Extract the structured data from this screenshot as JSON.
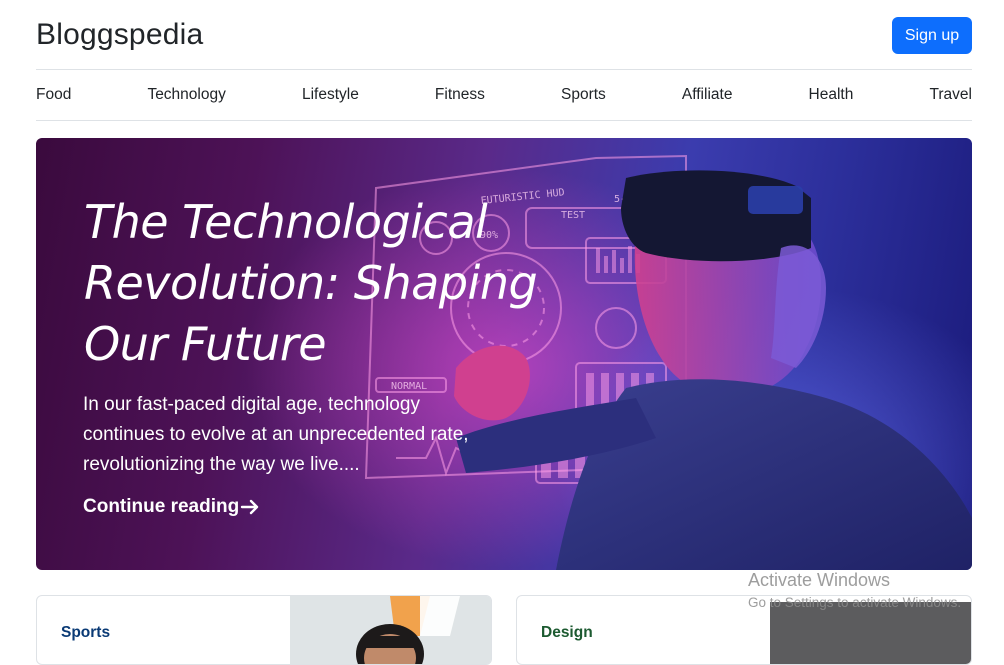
{
  "header": {
    "brand": "Bloggspedia",
    "signup_label": "Sign up"
  },
  "nav": {
    "items": [
      "Food",
      "Technology",
      "Lifestyle",
      "Fitness",
      "Sports",
      "Affiliate",
      "Health",
      "Travel"
    ]
  },
  "hero": {
    "title": "The Technological Revolution: Shaping Our Future",
    "lead": "In our fast-paced digital age, technology continues to evolve at an unprecedented rate, revolutionizing the way we live....",
    "link_label": "Continue reading",
    "link_icon": "arrow-right-icon",
    "hud_labels": [
      "FUTURISTIC HUD",
      "TEST",
      "90%",
      "NORMAL",
      "5-01"
    ]
  },
  "cards": [
    {
      "category": "Sports"
    },
    {
      "category": "Design"
    }
  ],
  "watermark": {
    "title": "Activate Windows",
    "subtitle": "Go to Settings to activate Windows."
  },
  "colors": {
    "primary": "#0d6efd",
    "text": "#212529",
    "border": "#dee2e6",
    "sports_category": "#0a3a75",
    "design_category": "#1c5a30"
  }
}
